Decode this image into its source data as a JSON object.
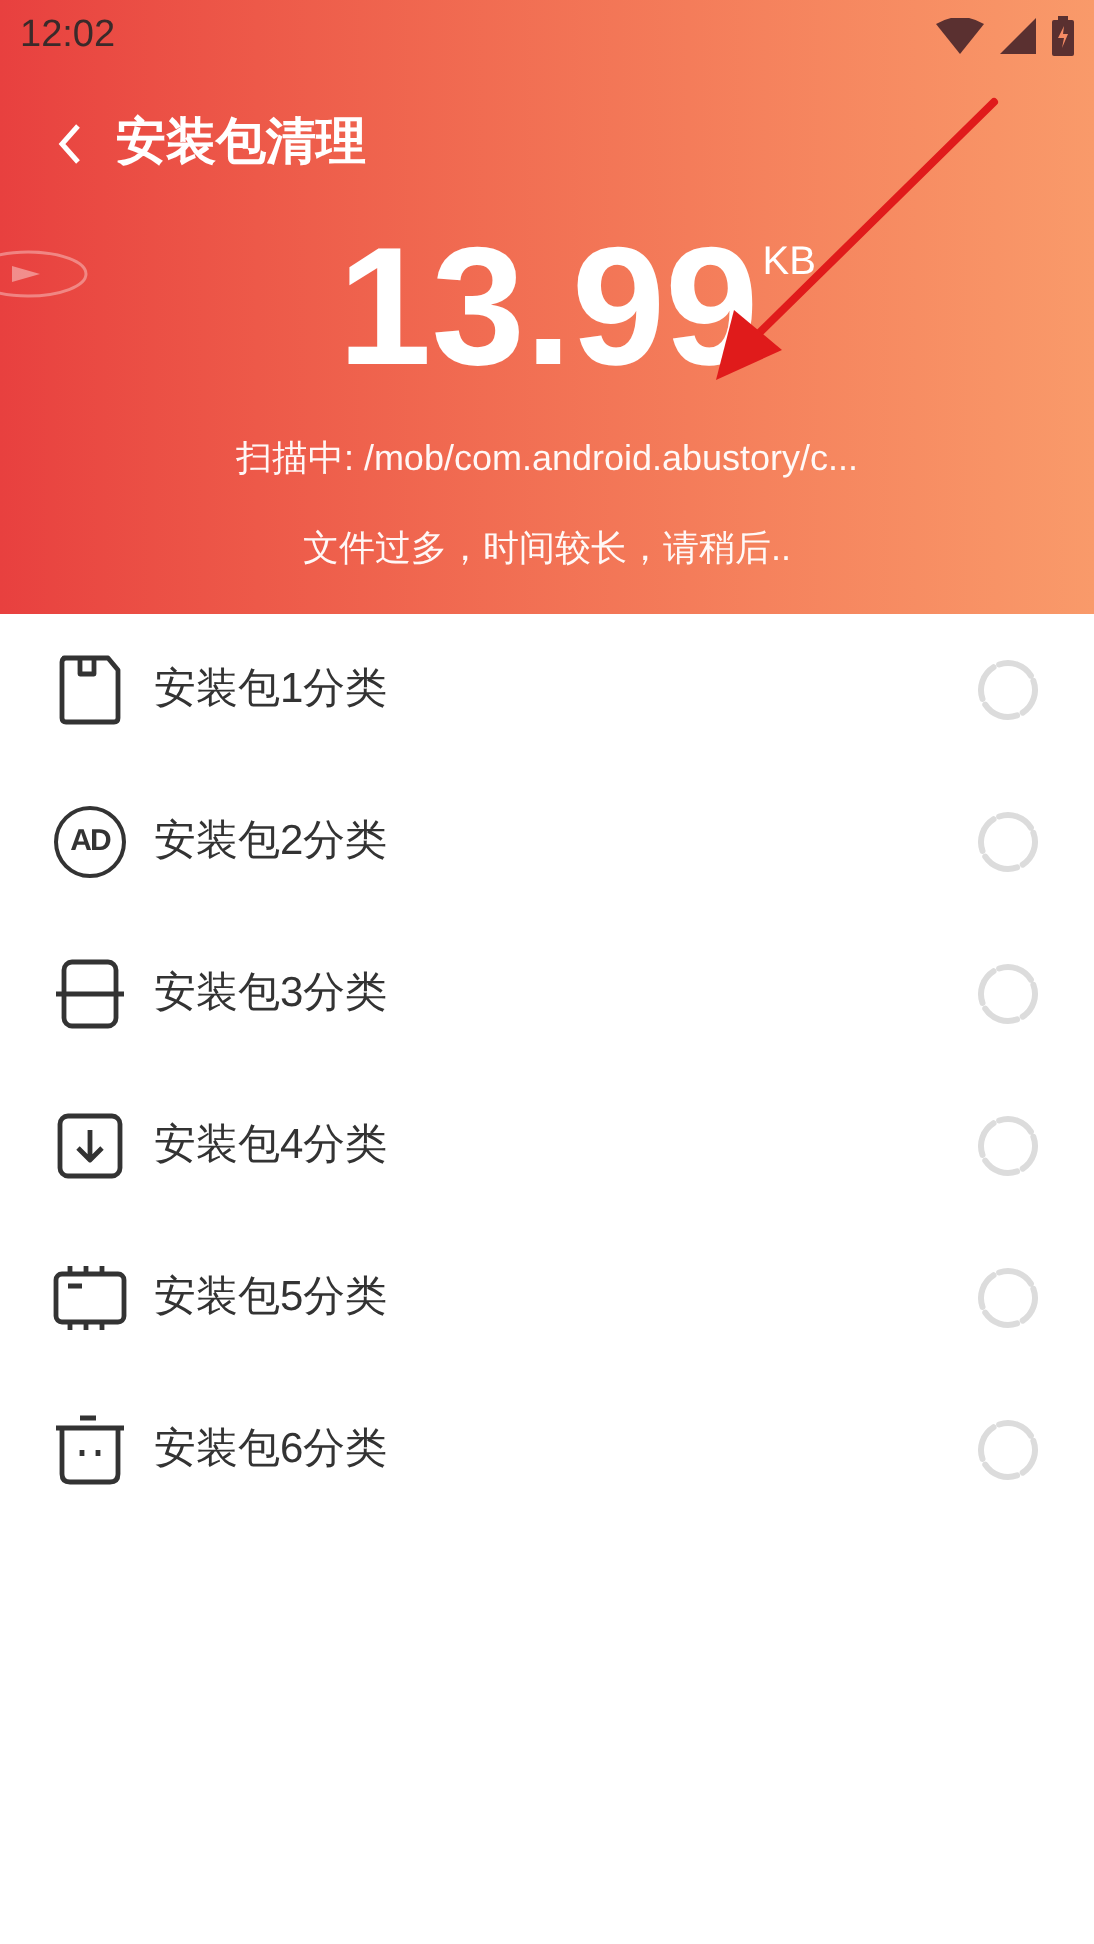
{
  "status_bar": {
    "time": "12:02"
  },
  "header": {
    "title": "安装包清理",
    "size": "13.99",
    "unit": "KB",
    "scan_status": "扫描中: /mob/com.android.abustory/c...",
    "hint": "文件过多，时间较长，请稍后.."
  },
  "categories": [
    {
      "kind": "card",
      "label": "安装包1分类"
    },
    {
      "kind": "ad",
      "badge": "AD",
      "label": "安装包2分类"
    },
    {
      "kind": "box",
      "label": "安装包3分类"
    },
    {
      "kind": "download",
      "label": "安装包4分类"
    },
    {
      "kind": "chip",
      "label": "安装包5分类"
    },
    {
      "kind": "trash",
      "label": "安装包6分类"
    }
  ]
}
